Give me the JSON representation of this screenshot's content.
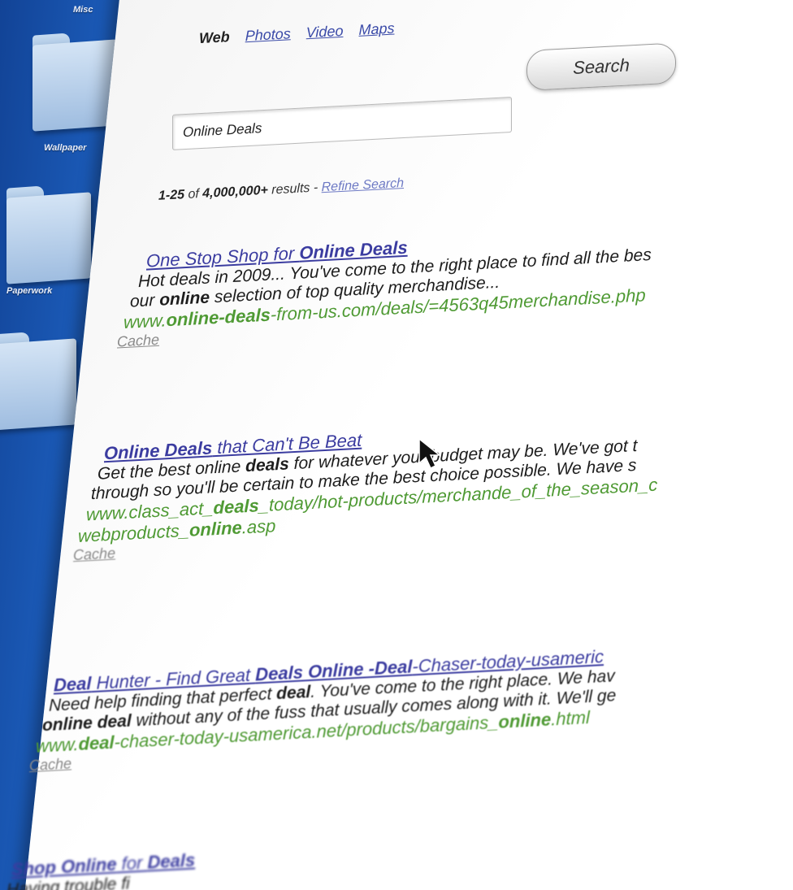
{
  "desktop": {
    "labels": {
      "misc": "Misc",
      "wallpaper": "Wallpaper",
      "paperwork": "Paperwork"
    }
  },
  "nav": {
    "web": "Web",
    "photos": "Photos",
    "video": "Video",
    "maps": "Maps"
  },
  "search": {
    "query": "Online Deals",
    "button": "Search"
  },
  "results_count": {
    "range": "1-25",
    "of": "of",
    "total": "4,000,000+",
    "suffix": "results -",
    "refine": "Refine Search"
  },
  "results": [
    {
      "title_plain": "One Stop Shop for ",
      "title_bold": "Online Deals",
      "snippet1": "Hot deals in 2009... You've come to the right place to find all the bes",
      "snippet2_pre": "our ",
      "snippet2_bold": "online",
      "snippet2_post": " selection of top quality merchandise...",
      "url_pre": "www.",
      "url_bold": "online-deals",
      "url_post": "-from-us.com/deals/=4563q45merchandise.php",
      "cache": "Cache"
    },
    {
      "title_bold": "Online Deals",
      "title_plain": " that Can't Be Beat",
      "snippet1_pre": "Get the best online ",
      "snippet1_bold": "deals",
      "snippet1_post": " for whatever your budget may be. We've got t",
      "snippet2": "through so you'll be certain to make the best choice possible. We have s",
      "url1_pre": "www.class_act_",
      "url1_bold": "deals",
      "url1_post": "_today/hot-products/merchande_of_the_season_c",
      "url2_pre": "webproducts_",
      "url2_bold": "online",
      "url2_post": ".asp",
      "cache": "Cache"
    },
    {
      "title_b1": "Deal",
      "title_p1": " Hunter - Find Great ",
      "title_b2": "Deals Online -Deal",
      "title_p2": "-Chaser-today-usameric",
      "snippet1_pre": "Need help finding that perfect ",
      "snippet1_bold": "deal",
      "snippet1_post": ". You've come to the right place. We hav",
      "snippet2_bold": "online deal",
      "snippet2_post": " without any of the fuss that usually comes along with it. We'll ge",
      "url_pre": "www.",
      "url_bold": "deal",
      "url_mid": "-chaser-today-usamerica.net/products/bargains_",
      "url_bold2": "online",
      "url_post": ".html",
      "cache": "Cache"
    },
    {
      "title_b1": "Shop Online",
      "title_p1": " for ",
      "title_b2": "Deals",
      "snippet": "Having trouble fi"
    }
  ],
  "colors": {
    "link": "#3b3ca0",
    "url": "#4f9a34",
    "desktop_blue": "#1a58b4"
  }
}
